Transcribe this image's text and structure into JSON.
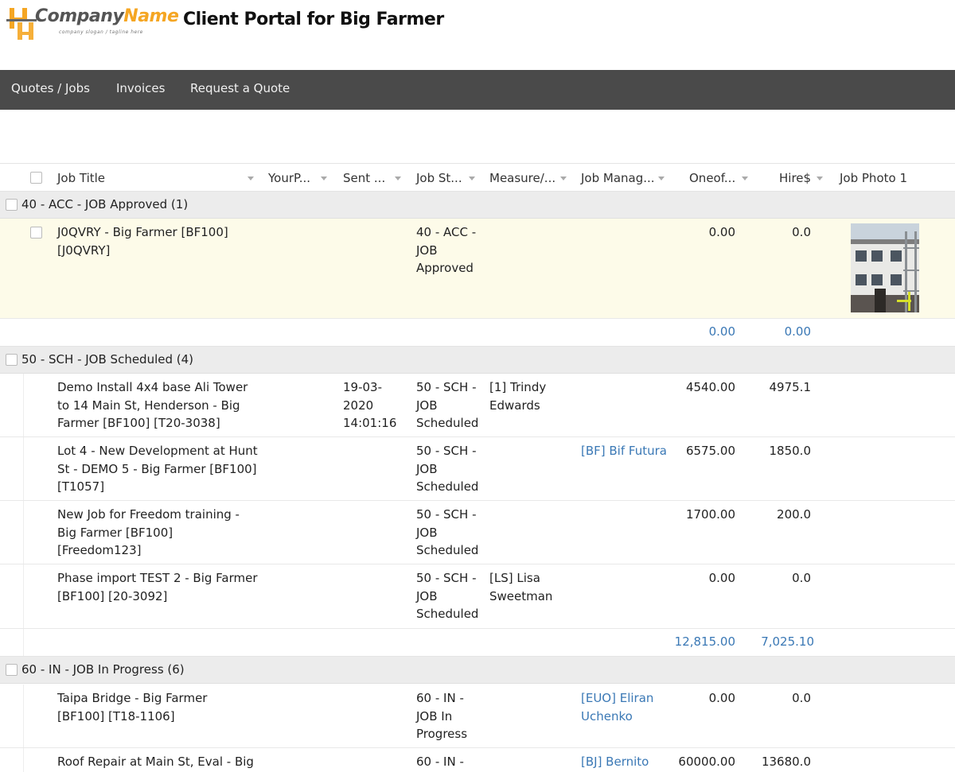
{
  "header": {
    "logo_company": "Company",
    "logo_name": "Name",
    "logo_slogan": "company slogan / tagline here",
    "title": "Client Portal for Big Farmer"
  },
  "nav": [
    "Quotes / Jobs",
    "Invoices",
    "Request a Quote"
  ],
  "columns": [
    "Job Title",
    "YourP...",
    "Sent ...",
    "Job St...",
    "Measure/...",
    "Job Manag...",
    "Oneof...",
    "Hire$",
    "Job Photo 1"
  ],
  "groups": [
    {
      "label": "40 - ACC - JOB Approved (1)",
      "rows": [
        {
          "title": "J0QVRY - Big Farmer [BF100] [J0QVRY]",
          "sent": "",
          "status": "40 - ACC - JOB Approved",
          "measure": "",
          "manager": "",
          "oneof": "0.00",
          "hire": "0.0",
          "photo": true
        }
      ],
      "sum_oneof": "0.00",
      "sum_hire": "0.00"
    },
    {
      "label": "50 - SCH - JOB Scheduled (4)",
      "rows": [
        {
          "title": "Demo Install 4x4 base Ali Tower to 14 Main St, Henderson - Big Farmer [BF100] [T20-3038]",
          "sent": "19-03-2020 14:01:16",
          "status": "50 - SCH - JOB Scheduled",
          "measure": "[1] Trindy Edwards",
          "manager": "",
          "oneof": "4540.00",
          "hire": "4975.1"
        },
        {
          "title": "Lot 4 - New Development at Hunt St - DEMO 5 - Big Farmer [BF100] [T1057]",
          "sent": "",
          "status": "50 - SCH - JOB Scheduled",
          "measure": "",
          "manager": "[BF] Bif Futura",
          "oneof": "6575.00",
          "hire": "1850.0"
        },
        {
          "title": "New Job for Freedom training - Big Farmer [BF100] [Freedom123]",
          "sent": "",
          "status": "50 - SCH - JOB Scheduled",
          "measure": "",
          "manager": "",
          "oneof": "1700.00",
          "hire": "200.0"
        },
        {
          "title": "Phase import TEST 2 - Big Farmer [BF100] [20-3092]",
          "sent": "",
          "status": "50 - SCH - JOB Scheduled",
          "measure": "[LS] Lisa Sweetman",
          "manager": "",
          "oneof": "0.00",
          "hire": "0.0"
        }
      ],
      "sum_oneof": "12,815.00",
      "sum_hire": "7,025.10"
    },
    {
      "label": "60 - IN - JOB In Progress (6)",
      "rows": [
        {
          "title": "Taipa Bridge - Big Farmer [BF100] [T18-1106]",
          "sent": "",
          "status": "60 - IN - JOB In Progress",
          "measure": "",
          "manager": "[EUO] Eliran Uchenko",
          "oneof": "0.00",
          "hire": "0.0"
        },
        {
          "title": "Roof Repair at Main St, Eval - Big",
          "sent": "",
          "status": "60 - IN -",
          "measure": "",
          "manager": "[BJ] Bernito",
          "oneof": "60000.00",
          "hire": "13680.0"
        }
      ]
    }
  ],
  "colors": {
    "nav_bg": "#4a4a4a",
    "link": "#3a78b5",
    "accent": "#f5a623",
    "group_bg": "#ececec",
    "selected_row": "#fdfbe9"
  }
}
